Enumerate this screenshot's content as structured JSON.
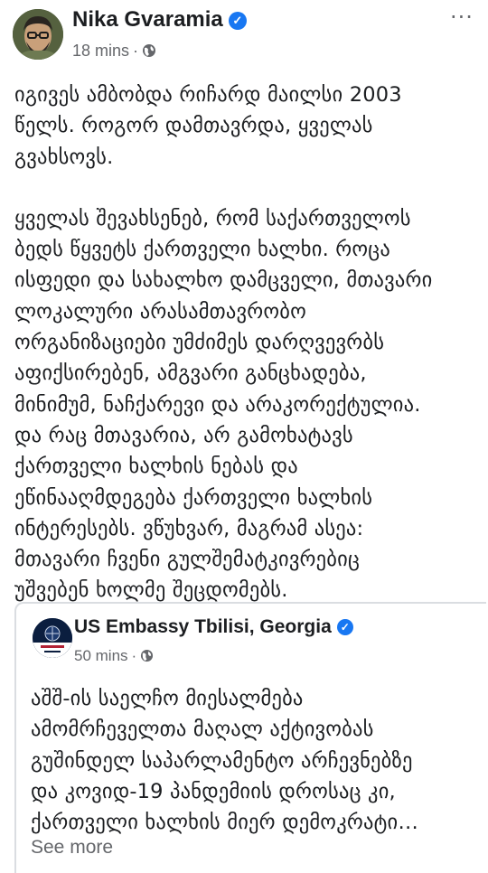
{
  "post": {
    "author": "Nika Gvaramia",
    "time": "18 mins",
    "separator": "·",
    "privacy_icon": "globe-icon",
    "more_icon": "ellipsis-icon",
    "paragraphs": [
      "იგივეს ამბობდა რიჩარდ მაილსი 2003\nწელს. როგორ დამთავრდა, ყველას\nგვახსოვს.",
      "ყველას შევახსენებ, რომ საქართველოს\nბედს წყვეტს ქართველი ხალხი. როცა\nისფედი და სახალხო დამცველი, მთავარი\nლოკალური არასამთავრობო\nორგანიზაციები უმძიმეს დარღვევრბს\nაფიქსირებენ, ამგვარი განცხადება,\nმინიმუმ, ნაჩქარევი და არაკორექტულია.\nდა რაც მთავარია, არ გამოხატავს\nქართველი ხალხის ნებას და\nეწინააღმდეგება ქართველი ხალხის\nინტერესებს. ვწუხვარ, მაგრამ ასეა:\nმთავარი ჩვენი გულშემატკივრებიც\nუშვებენ ხოლმე შეცდომებს."
    ]
  },
  "shared": {
    "author": "US Embassy Tbilisi, Georgia",
    "avatar_text": "US Embassy\nGeorgia",
    "time": "50 mins",
    "separator": "·",
    "privacy_icon": "globe-icon",
    "text": "აშშ-ის საელჩო მიესალმება\nამომრჩეველთა მაღალ აქტივობას\nგუშინდელ საპარლამენტო არჩევნებზე\nდა კოვიდ-19 პანდემიის დროსაც კი,\nქართველი ხალხის მიერ დემოკრატი…",
    "see_more": "See more"
  },
  "colors": {
    "verified": "#1877f2",
    "meta_text": "#65676b",
    "body_text": "#1c1e21",
    "card_border": "#dadde1"
  }
}
